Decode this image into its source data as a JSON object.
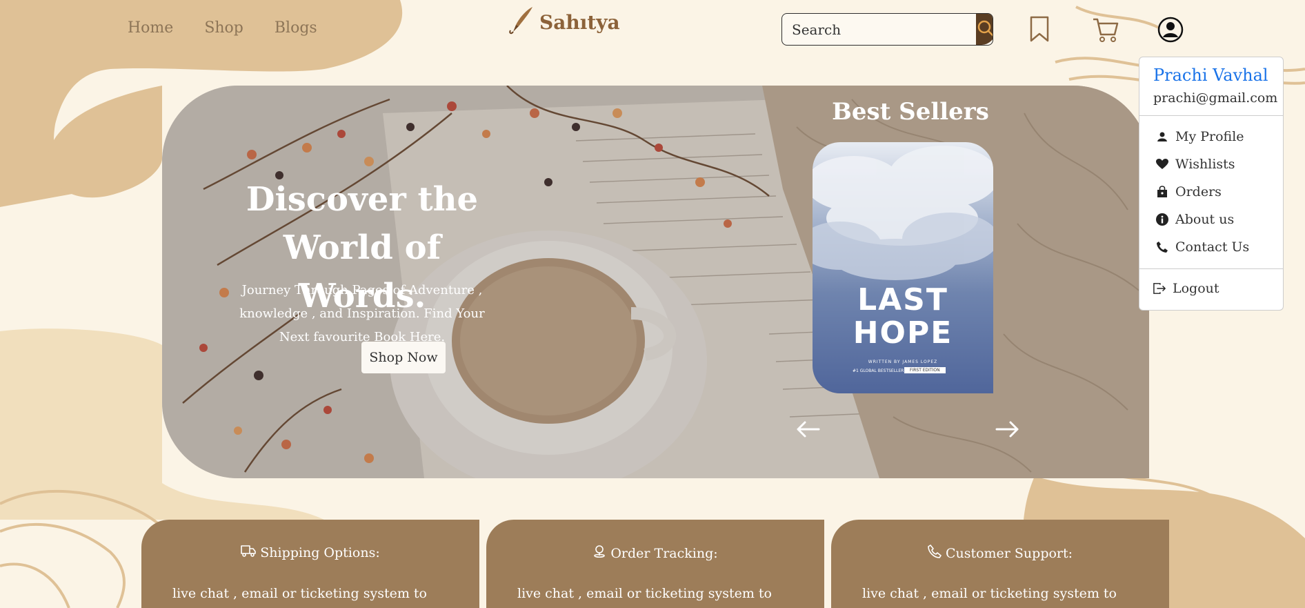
{
  "nav": {
    "links": [
      "Home",
      "Shop",
      "Blogs"
    ],
    "logo_text": "Sahıtya"
  },
  "search": {
    "placeholder": "Search"
  },
  "icons": {
    "search": "search-icon",
    "bookmark": "bookmark-icon",
    "cart": "cart-icon",
    "account": "user-circle-icon"
  },
  "hero": {
    "title": "Discover the World of Words.",
    "subtitle": "Journey Through Pages of Adventure , knowledge , and Inspiration. Find Your Next favourite Book Here.",
    "cta_label": "Shop Now"
  },
  "best_sellers": {
    "title": "Best Sellers",
    "book": {
      "title": "LAST HOPE",
      "author_line": "WRITTEN BY JAMES LOPEZ",
      "tag_left": "#1 GLOBAL BESTSELLER",
      "tag_right": "FIRST EDITION"
    }
  },
  "dropdown": {
    "name": "Prachi Vavhal",
    "email": "prachi@gmail.com",
    "items": [
      {
        "label": "My Profile",
        "icon": "person-icon"
      },
      {
        "label": "Wishlists",
        "icon": "heart-icon"
      },
      {
        "label": "Orders",
        "icon": "bag-icon"
      },
      {
        "label": "About us",
        "icon": "info-icon"
      },
      {
        "label": "Contact Us",
        "icon": "phone-icon"
      }
    ],
    "logout_label": "Logout"
  },
  "cards": [
    {
      "title": "Shipping Options:",
      "icon": "truck-icon",
      "text": "live chat , email or ticketing system to"
    },
    {
      "title": "Order Tracking:",
      "icon": "location-icon",
      "text": "live chat , email or ticketing system to"
    },
    {
      "title": "Customer Support:",
      "icon": "phone-icon",
      "text": "live chat , email or ticketing system to"
    }
  ],
  "colors": {
    "background": "#fbf4e6",
    "blob": "#dfc196",
    "accent_brown": "#5a3d22",
    "card": "#9d7d59",
    "name_blue": "#1a73e8"
  }
}
